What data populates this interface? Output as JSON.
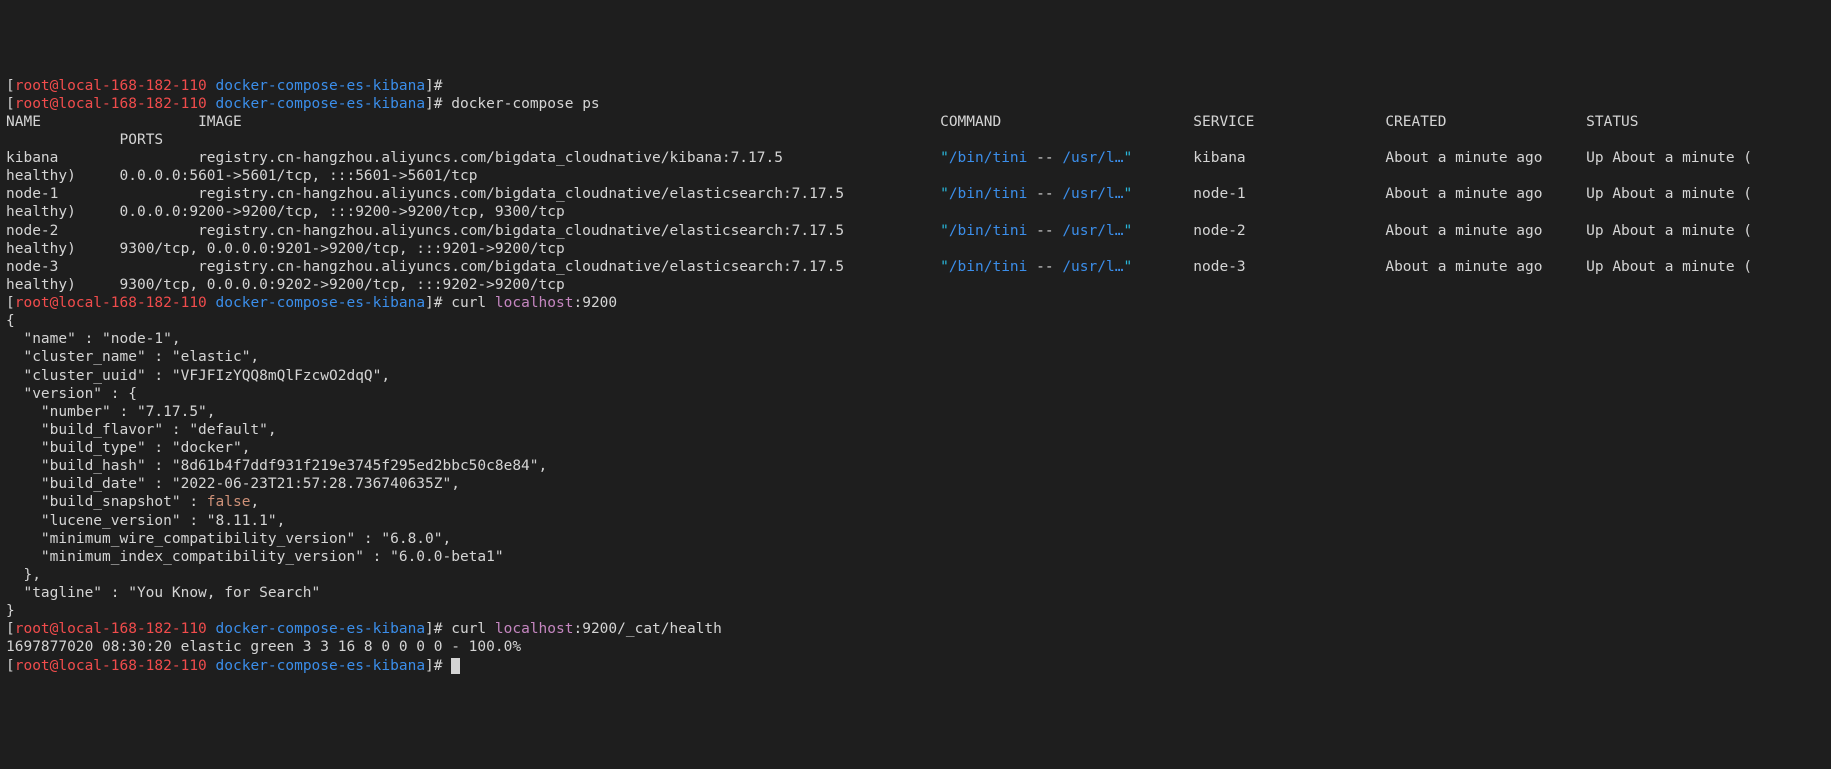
{
  "prompt": {
    "bracket_open": "[",
    "userhost": "root@local-168-182-110",
    "dir": "docker-compose-es-kibana",
    "bracket_close": "]#"
  },
  "cmd_ps": "docker-compose ps",
  "ps_header": {
    "name": "NAME",
    "image": "IMAGE",
    "command": "COMMAND",
    "service": "SERVICE",
    "created": "CREATED",
    "status": "STATUS",
    "ports": "PORTS"
  },
  "ps_rows": [
    {
      "name": "kibana",
      "image": "registry.cn-hangzhou.aliyuncs.com/bigdata_cloudnative/kibana:7.17.5",
      "command_q1": "\"",
      "command_exe": "/bin/tini",
      "command_mid": " -- ",
      "command_tail": "/usr/l…",
      "command_q2": "\"",
      "service": "kibana",
      "created": "About a minute ago",
      "status": "Up About a minute (",
      "health": "healthy)",
      "ports": "0.0.0.0:5601->5601/tcp, :::5601->5601/tcp"
    },
    {
      "name": "node-1",
      "image": "registry.cn-hangzhou.aliyuncs.com/bigdata_cloudnative/elasticsearch:7.17.5",
      "command_q1": "\"",
      "command_exe": "/bin/tini",
      "command_mid": " -- ",
      "command_tail": "/usr/l…",
      "command_q2": "\"",
      "service": "node-1",
      "created": "About a minute ago",
      "status": "Up About a minute (",
      "health": "healthy)",
      "ports": "0.0.0.0:9200->9200/tcp, :::9200->9200/tcp, 9300/tcp"
    },
    {
      "name": "node-2",
      "image": "registry.cn-hangzhou.aliyuncs.com/bigdata_cloudnative/elasticsearch:7.17.5",
      "command_q1": "\"",
      "command_exe": "/bin/tini",
      "command_mid": " -- ",
      "command_tail": "/usr/l…",
      "command_q2": "\"",
      "service": "node-2",
      "created": "About a minute ago",
      "status": "Up About a minute (",
      "health": "healthy)",
      "ports": "9300/tcp, 0.0.0.0:9201->9200/tcp, :::9201->9200/tcp"
    },
    {
      "name": "node-3",
      "image": "registry.cn-hangzhou.aliyuncs.com/bigdata_cloudnative/elasticsearch:7.17.5",
      "command_q1": "\"",
      "command_exe": "/bin/tini",
      "command_mid": " -- ",
      "command_tail": "/usr/l…",
      "command_q2": "\"",
      "service": "node-3",
      "created": "About a minute ago",
      "status": "Up About a minute (",
      "health": "healthy)",
      "ports": "9300/tcp, 0.0.0.0:9202->9200/tcp, :::9202->9200/tcp"
    }
  ],
  "curl1": {
    "cmd": "curl",
    "host": "localhost",
    "port": ":9200"
  },
  "json": {
    "l0": "{",
    "l1": "  \"name\" : \"node-1\",",
    "l2": "  \"cluster_name\" : \"elastic\",",
    "l3": "  \"cluster_uuid\" : \"VFJFIzYQQ8mQlFzcwO2dqQ\",",
    "l4": "  \"version\" : {",
    "l5": "    \"number\" : \"7.17.5\",",
    "l6": "    \"build_flavor\" : \"default\",",
    "l7": "    \"build_type\" : \"docker\",",
    "l8": "    \"build_hash\" : \"8d61b4f7ddf931f219e3745f295ed2bbc50c8e84\",",
    "l9": "    \"build_date\" : \"2022-06-23T21:57:28.736740635Z\",",
    "l10a": "    \"build_snapshot\" : ",
    "l10b": "false",
    "l10c": ",",
    "l11": "    \"lucene_version\" : \"8.11.1\",",
    "l12": "    \"minimum_wire_compatibility_version\" : \"6.8.0\",",
    "l13": "    \"minimum_index_compatibility_version\" : \"6.0.0-beta1\"",
    "l14": "  },",
    "l15": "  \"tagline\" : \"You Know, for Search\"",
    "l16": "}"
  },
  "curl2": {
    "cmd": "curl",
    "host": "localhost",
    "tail": ":9200/_cat/health"
  },
  "health_line": "1697877020 08:30:20 elastic green 3 3 16 8 0 0 0 0 - 100.0%",
  "space": " "
}
